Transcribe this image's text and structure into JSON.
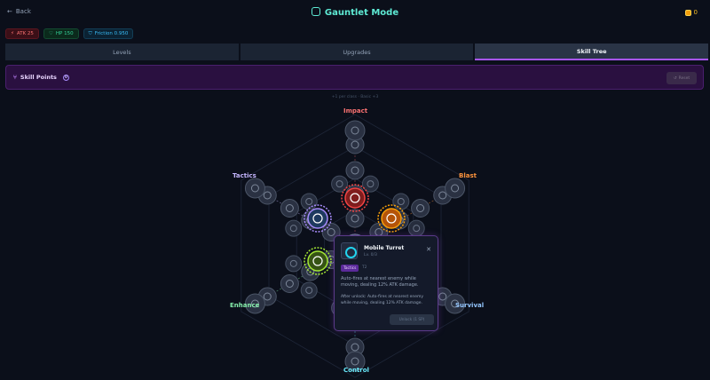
{
  "header": {
    "back_label": "Back",
    "title": "Gauntlet Mode",
    "coins": "0"
  },
  "stats": [
    {
      "label": "ATK 25"
    },
    {
      "label": "HP 150"
    },
    {
      "label": "Friction 0.950"
    }
  ],
  "tabs": [
    {
      "label": "Levels",
      "active": false
    },
    {
      "label": "Upgrades",
      "active": false
    },
    {
      "label": "Skill Tree",
      "active": true
    }
  ],
  "skill_points": {
    "label": "Skill Points",
    "value": "0",
    "reset_label": "Reset"
  },
  "hint": "+1 per class · Basic +3",
  "branches": [
    {
      "name": "Impact",
      "color": "#f87171"
    },
    {
      "name": "Blast",
      "color": "#fb923c"
    },
    {
      "name": "Survival",
      "color": "#93c5fd"
    },
    {
      "name": "Control",
      "color": "#67e8f9"
    },
    {
      "name": "Enhance",
      "color": "#86efac"
    },
    {
      "name": "Tactics",
      "color": "#c4b5fd"
    }
  ],
  "tooltip": {
    "name": "Mobile Turret",
    "level": "Lv. 0/3",
    "tag": "Tactics",
    "tier": "T2",
    "description": "Auto-fires at nearest enemy while moving, dealing 12% ATK damage.",
    "after_unlock": "After unlock: Auto-fires at nearest enemy while moving, dealing 12% ATK damage.",
    "unlock_label": "Unlock (1 SP)"
  },
  "icons": {
    "back": "arrow-left-icon",
    "title": "gauntlet-icon",
    "coin": "coin-icon",
    "atk": "lightning-icon",
    "hp": "heart-icon",
    "friction": "shield-icon",
    "skill_points": "branch-icon",
    "reset": "reset-icon",
    "close": "close-icon"
  },
  "colors": {
    "accent": "#a855f7",
    "title": "#5eead4",
    "coin": "#f59e0b"
  }
}
